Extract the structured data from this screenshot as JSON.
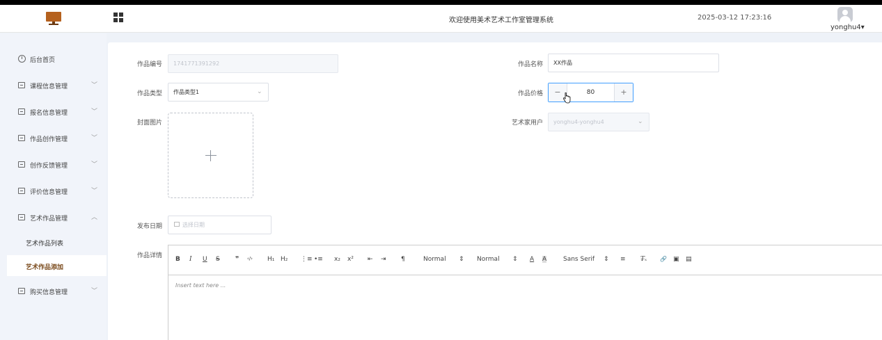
{
  "header": {
    "title": "欢迎使用美术艺术工作室管理系统",
    "datetime": "2025-03-12 17:23:16",
    "username": "yonghu4",
    "user_caret": "▾"
  },
  "sidebar": {
    "items": [
      {
        "label": "后台首页"
      },
      {
        "label": "课程信息管理",
        "chevron": "﹀"
      },
      {
        "label": "报名信息管理",
        "chevron": "﹀"
      },
      {
        "label": "作品创作管理",
        "chevron": "﹀"
      },
      {
        "label": "创作反馈管理",
        "chevron": "﹀"
      },
      {
        "label": "评价信息管理",
        "chevron": "﹀"
      },
      {
        "label": "艺术作品管理",
        "chevron": "︿"
      },
      {
        "label": "购买信息管理",
        "chevron": "﹀"
      }
    ],
    "subitems": [
      {
        "label": "艺术作品列表"
      },
      {
        "label": "艺术作品添加"
      }
    ]
  },
  "form": {
    "work_no": {
      "label": "作品编号",
      "value": "1741771391292"
    },
    "work_name": {
      "label": "作品名称",
      "value": "XX作品"
    },
    "work_type": {
      "label": "作品类型",
      "value": "作品类型1"
    },
    "work_price": {
      "label": "作品价格",
      "value": "80",
      "minus": "−",
      "plus": "+"
    },
    "cover": {
      "label": "封面图片"
    },
    "artist": {
      "label": "艺术家用户",
      "value": "yonghu4-yonghu4"
    },
    "publish_date": {
      "label": "发布日期",
      "placeholder": "选择日期"
    },
    "detail": {
      "label": "作品详情"
    }
  },
  "editor": {
    "toolbar": {
      "bold": "B",
      "italic": "I",
      "underline": "U",
      "strike": "S",
      "blockquote": "❞",
      "code": "‹/›",
      "h1": "H₁",
      "h2": "H₂",
      "ol": "⋮≡",
      "ul": "•≡",
      "sub": "x₂",
      "sup": "x²",
      "indent_dec": "⇤",
      "indent_inc": "⇥",
      "direction": "¶",
      "size": "Normal",
      "header": "Normal",
      "select_arrow": "⇕",
      "color": "A",
      "background": "A",
      "font": "Sans Serif",
      "align": "≡",
      "clean": "T̶ₓ",
      "link": "🔗",
      "image": "▣",
      "video": "▤"
    },
    "placeholder": "Insert text here ..."
  }
}
